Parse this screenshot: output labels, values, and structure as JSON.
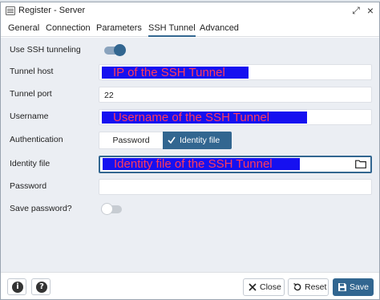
{
  "window": {
    "title": "Register - Server"
  },
  "tabs": [
    {
      "label": "General",
      "active": false
    },
    {
      "label": "Connection",
      "active": false
    },
    {
      "label": "Parameters",
      "active": false
    },
    {
      "label": "SSH Tunnel",
      "active": true
    },
    {
      "label": "Advanced",
      "active": false
    }
  ],
  "form": {
    "use_ssh_tunneling": {
      "label": "Use SSH tunneling",
      "value": true
    },
    "tunnel_host": {
      "label": "Tunnel host",
      "value": "IP of the SSH Tunnel"
    },
    "tunnel_port": {
      "label": "Tunnel port",
      "value": "22"
    },
    "username": {
      "label": "Username",
      "value": "Username of the SSH Tunnel"
    },
    "authentication": {
      "label": "Authentication",
      "options": [
        "Password",
        "Identity file"
      ],
      "selected": "Identity file"
    },
    "identity_file": {
      "label": "Identity file",
      "value": "Identity file of the SSH Tunnel",
      "icon": "folder-icon"
    },
    "password": {
      "label": "Password",
      "value": ""
    },
    "save_password": {
      "label": "Save password?",
      "value": false
    }
  },
  "footer": {
    "info_icon": "info-icon",
    "help_icon": "help-icon",
    "close_label": "Close",
    "reset_label": "Reset",
    "save_label": "Save"
  },
  "colors": {
    "accent": "#326690",
    "panel_bg": "#ebeef3",
    "redaction_fill": "#1610f0",
    "redaction_text": "#ff3b5c"
  }
}
